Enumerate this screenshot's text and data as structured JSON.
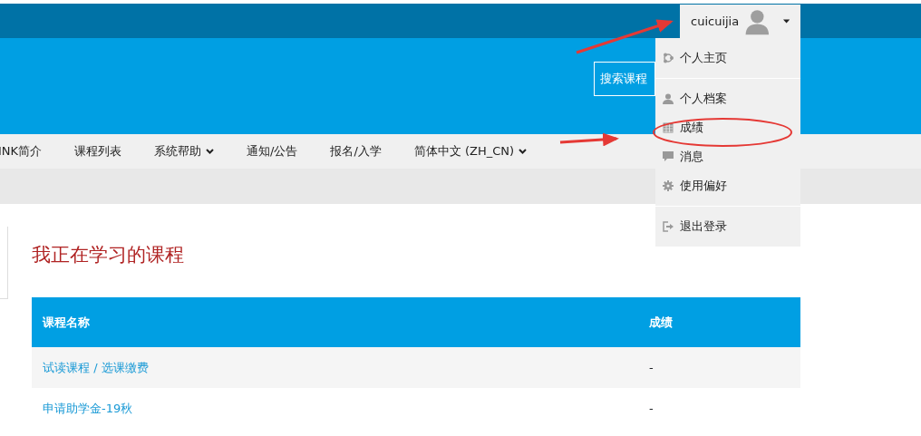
{
  "user_menu": {
    "username": "cuicuijia",
    "expanded": true,
    "groups": [
      [
        {
          "kind": "home",
          "label": "个人主页"
        }
      ],
      [
        {
          "kind": "profile",
          "label": "个人档案"
        },
        {
          "kind": "grades",
          "label": "成绩"
        },
        {
          "kind": "messages",
          "label": "消息"
        },
        {
          "kind": "preferences",
          "label": "使用偏好"
        }
      ],
      [
        {
          "kind": "logout",
          "label": "退出登录"
        }
      ]
    ]
  },
  "header": {
    "search_button": "搜索课程"
  },
  "nav": [
    {
      "label": "INK简介",
      "dropdown": false
    },
    {
      "label": "课程列表",
      "dropdown": false
    },
    {
      "label": "系统帮助",
      "dropdown": true
    },
    {
      "label": "通知/公告",
      "dropdown": false
    },
    {
      "label": "报名/入学",
      "dropdown": false
    },
    {
      "label": "简体中文 (ZH_CN)",
      "dropdown": true
    }
  ],
  "main": {
    "heading": "我正在学习的课程",
    "table": {
      "columns": [
        "课程名称",
        "成绩"
      ],
      "rows": [
        {
          "course": "试读课程 / 选课缴费",
          "grade": "-"
        },
        {
          "course": "申请助学金-19秋",
          "grade": "-"
        }
      ]
    }
  }
}
